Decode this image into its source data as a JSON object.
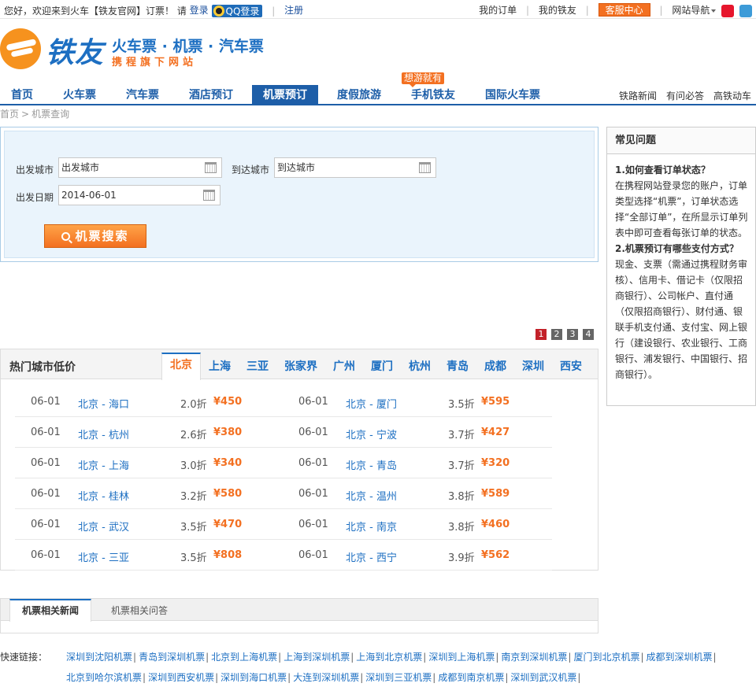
{
  "topbar": {
    "greeting": "您好，欢迎来到火车【铁友官网】订票！ 请",
    "login": "登录",
    "qq_login": "QQ登录",
    "register": "注册",
    "my_orders": "我的订单",
    "my_tieyou": "我的铁友",
    "service": "客服中心",
    "site_nav": "网站导航"
  },
  "logo": {
    "name": "铁友",
    "slogan": "火车票 · 机票 · 汽车票",
    "sub": "携程旗下网站"
  },
  "nav": {
    "items": [
      "首页",
      "火车票",
      "汽车票",
      "酒店预订",
      "机票预订",
      "度假旅游",
      "手机铁友",
      "国际火车票"
    ],
    "active": "机票预订",
    "badge": "想游就有",
    "right": [
      "铁路新闻",
      "有问必答",
      "高铁动车"
    ]
  },
  "breadcrumb": [
    "首页",
    "机票查询"
  ],
  "search": {
    "from_label": "出发城市",
    "from_placeholder": "出发城市",
    "to_label": "到达城市",
    "to_placeholder": "到达城市",
    "date_label": "出发日期",
    "date_value": "2014-06-01",
    "button": "机票搜索"
  },
  "pager": [
    "1",
    "2",
    "3",
    "4"
  ],
  "hot": {
    "title": "热门城市低价",
    "tabs": [
      "北京",
      "上海",
      "三亚",
      "张家界",
      "广州",
      "厦门",
      "杭州",
      "青岛",
      "成都",
      "深圳",
      "西安"
    ],
    "active_tab": "北京",
    "rows": [
      [
        {
          "date": "06-01",
          "route": "北京 - 海口",
          "disc": "2.0折",
          "price": "¥450"
        },
        {
          "date": "06-01",
          "route": "北京 - 厦门",
          "disc": "3.5折",
          "price": "¥595"
        }
      ],
      [
        {
          "date": "06-01",
          "route": "北京 - 杭州",
          "disc": "2.6折",
          "price": "¥380"
        },
        {
          "date": "06-01",
          "route": "北京 - 宁波",
          "disc": "3.7折",
          "price": "¥427"
        }
      ],
      [
        {
          "date": "06-01",
          "route": "北京 - 上海",
          "disc": "3.0折",
          "price": "¥340"
        },
        {
          "date": "06-01",
          "route": "北京 - 青岛",
          "disc": "3.7折",
          "price": "¥320"
        }
      ],
      [
        {
          "date": "06-01",
          "route": "北京 - 桂林",
          "disc": "3.2折",
          "price": "¥580"
        },
        {
          "date": "06-01",
          "route": "北京 - 温州",
          "disc": "3.8折",
          "price": "¥589"
        }
      ],
      [
        {
          "date": "06-01",
          "route": "北京 - 武汉",
          "disc": "3.5折",
          "price": "¥470"
        },
        {
          "date": "06-01",
          "route": "北京 - 南京",
          "disc": "3.8折",
          "price": "¥460"
        }
      ],
      [
        {
          "date": "06-01",
          "route": "北京 - 三亚",
          "disc": "3.5折",
          "price": "¥808"
        },
        {
          "date": "06-01",
          "route": "北京 - 西宁",
          "disc": "3.9折",
          "price": "¥562"
        }
      ]
    ]
  },
  "news": {
    "tabs": [
      "机票相关新闻",
      "机票相关问答"
    ]
  },
  "quick": {
    "label": "快速链接：",
    "line1": [
      "深圳到沈阳机票",
      "青岛到深圳机票",
      "北京到上海机票",
      "上海到深圳机票",
      "上海到北京机票",
      "深圳到上海机票",
      "南京到深圳机票",
      "厦门到北京机票",
      "成都到深圳机票"
    ],
    "line2": [
      "北京到哈尔滨机票",
      "深圳到西安机票",
      "深圳到海口机票",
      "大连到深圳机票",
      "深圳到三亚机票",
      "成都到南京机票",
      "深圳到武汉机票"
    ]
  },
  "faq": {
    "title": "常见问题",
    "q1": "1.如何查看订单状态？",
    "a1": "在携程网站登录您的账户，订单类型选择“机票”，订单状态选择“全部订单”，在所显示订单列表中即可查看每张订单的状态。",
    "q2": "2.机票预订有哪些支付方式？",
    "a2": "现金、支票（需通过携程财务审核）、信用卡、借记卡（仅限招商银行）、公司帐户、直付通（仅限招商银行）、财付通、银联手机支付通、支付宝、网上银行（建设银行、农业银行、工商银行、浦发银行、中国银行、招商银行）。"
  }
}
